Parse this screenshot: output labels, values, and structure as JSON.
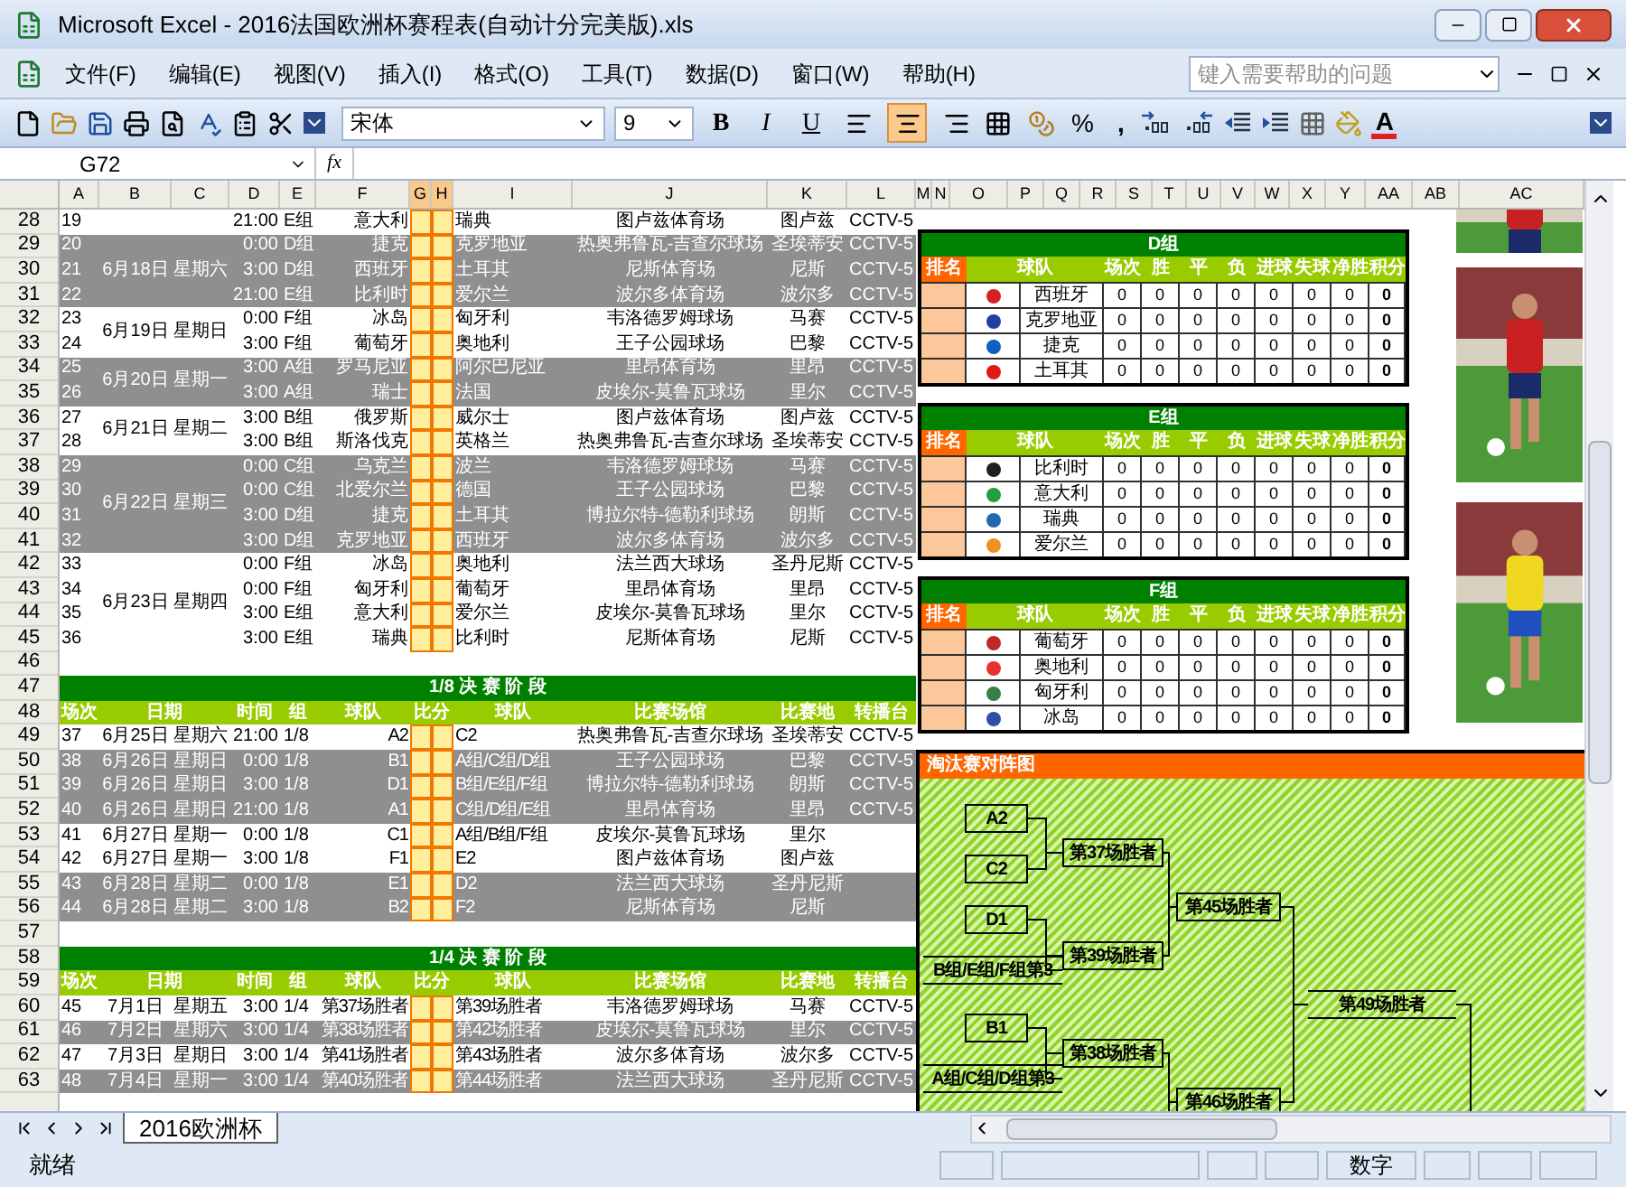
{
  "window": {
    "title": "Microsoft Excel - 2016法国欧洲杯赛程表(自动计分完美版).xls"
  },
  "menu": [
    "文件(F)",
    "编辑(E)",
    "视图(V)",
    "插入(I)",
    "格式(O)",
    "工具(T)",
    "数据(D)",
    "窗口(W)",
    "帮助(H)"
  ],
  "help_box": {
    "placeholder": "键入需要帮助的问题"
  },
  "toolbar": {
    "font": "宋体",
    "size": "9",
    "style_buttons": [
      "B",
      "I",
      "U"
    ],
    "align": [
      {
        "selected": false
      },
      {
        "selected": true
      },
      {
        "selected": false
      }
    ],
    "percent": "%",
    "comma": ",",
    "font_color": "A"
  },
  "formula_bar": {
    "name_box": "G72",
    "fx": "fx"
  },
  "columns": [
    {
      "label": "A",
      "selected": false
    },
    {
      "label": "B",
      "selected": false
    },
    {
      "label": "C",
      "selected": false
    },
    {
      "label": "D",
      "selected": false
    },
    {
      "label": "E",
      "selected": false
    },
    {
      "label": "F",
      "selected": false
    },
    {
      "label": "G",
      "selected": true
    },
    {
      "label": "H",
      "selected": true
    },
    {
      "label": "I",
      "selected": false
    },
    {
      "label": "J",
      "selected": false
    },
    {
      "label": "K",
      "selected": false
    },
    {
      "label": "L",
      "selected": false
    },
    {
      "label": "M",
      "selected": false
    },
    {
      "label": "N",
      "selected": false
    },
    {
      "label": "O",
      "selected": false
    },
    {
      "label": "P",
      "selected": false
    },
    {
      "label": "Q",
      "selected": false
    },
    {
      "label": "R",
      "selected": false
    },
    {
      "label": "S",
      "selected": false
    },
    {
      "label": "T",
      "selected": false
    },
    {
      "label": "U",
      "selected": false
    },
    {
      "label": "V",
      "selected": false
    },
    {
      "label": "W",
      "selected": false
    },
    {
      "label": "X",
      "selected": false
    },
    {
      "label": "Y",
      "selected": false
    },
    {
      "label": "AA",
      "selected": false
    },
    {
      "label": "AB",
      "selected": false
    },
    {
      "label": "AC",
      "selected": false
    }
  ],
  "row_numbers": [
    "28",
    "29",
    "30",
    "31",
    "32",
    "33",
    "34",
    "35",
    "36",
    "37",
    "38",
    "39",
    "40",
    "41",
    "42",
    "43",
    "44",
    "45",
    "46",
    "47",
    "48",
    "49",
    "50",
    "51",
    "52",
    "53",
    "54",
    "55",
    "56",
    "57",
    "58",
    "59",
    "60",
    "61",
    "62",
    "63"
  ],
  "group_stage": [
    {
      "shaded": false,
      "matches": [
        {
          "no": "19",
          "time": "21:00",
          "group": "E组",
          "team1": "意大利",
          "team2": "瑞典",
          "venue": "图卢兹体育场",
          "city": "图卢兹",
          "tv": "CCTV-5"
        }
      ]
    },
    {
      "date": "6月18日",
      "weekday": "星期六",
      "shaded": true,
      "matches": [
        {
          "no": "20",
          "time": "0:00",
          "group": "D组",
          "team1": "捷克",
          "team2": "克罗地亚",
          "venue": "热奥弗鲁瓦-吉查尔球场",
          "city": "圣埃蒂安",
          "tv": "CCTV-5"
        },
        {
          "no": "21",
          "time": "3:00",
          "group": "D组",
          "team1": "西班牙",
          "team2": "土耳其",
          "venue": "尼斯体育场",
          "city": "尼斯",
          "tv": "CCTV-5"
        },
        {
          "no": "22",
          "time": "21:00",
          "group": "E组",
          "team1": "比利时",
          "team2": "爱尔兰",
          "venue": "波尔多体育场",
          "city": "波尔多",
          "tv": "CCTV-5"
        }
      ]
    },
    {
      "date": "6月19日",
      "weekday": "星期日",
      "shaded": false,
      "matches": [
        {
          "no": "23",
          "time": "0:00",
          "group": "F组",
          "team1": "冰岛",
          "team2": "匈牙利",
          "venue": "韦洛德罗姆球场",
          "city": "马赛",
          "tv": "CCTV-5"
        },
        {
          "no": "24",
          "time": "3:00",
          "group": "F组",
          "team1": "葡萄牙",
          "team2": "奥地利",
          "venue": "王子公园球场",
          "city": "巴黎",
          "tv": "CCTV-5"
        }
      ]
    },
    {
      "date": "6月20日",
      "weekday": "星期一",
      "shaded": true,
      "matches": [
        {
          "no": "25",
          "time": "3:00",
          "group": "A组",
          "team1": "罗马尼亚",
          "team2": "阿尔巴尼亚",
          "venue": "里昂体育场",
          "city": "里昂",
          "tv": "CCTV-5"
        },
        {
          "no": "26",
          "time": "3:00",
          "group": "A组",
          "team1": "瑞士",
          "team2": "法国",
          "venue": "皮埃尔-莫鲁瓦球场",
          "city": "里尔",
          "tv": "CCTV-5"
        }
      ]
    },
    {
      "date": "6月21日",
      "weekday": "星期二",
      "shaded": false,
      "matches": [
        {
          "no": "27",
          "time": "3:00",
          "group": "B组",
          "team1": "俄罗斯",
          "team2": "威尔士",
          "venue": "图卢兹体育场",
          "city": "图卢兹",
          "tv": "CCTV-5"
        },
        {
          "no": "28",
          "time": "3:00",
          "group": "B组",
          "team1": "斯洛伐克",
          "team2": "英格兰",
          "venue": "热奥弗鲁瓦-吉查尔球场",
          "city": "圣埃蒂安",
          "tv": "CCTV-5"
        }
      ]
    },
    {
      "date": "6月22日",
      "weekday": "星期三",
      "shaded": true,
      "matches": [
        {
          "no": "29",
          "time": "0:00",
          "group": "C组",
          "team1": "乌克兰",
          "team2": "波兰",
          "venue": "韦洛德罗姆球场",
          "city": "马赛",
          "tv": "CCTV-5"
        },
        {
          "no": "30",
          "time": "0:00",
          "group": "C组",
          "team1": "北爱尔兰",
          "team2": "德国",
          "venue": "王子公园球场",
          "city": "巴黎",
          "tv": "CCTV-5"
        },
        {
          "no": "31",
          "time": "3:00",
          "group": "D组",
          "team1": "捷克",
          "team2": "土耳其",
          "venue": "博拉尔特-德勒利球场",
          "city": "朗斯",
          "tv": "CCTV-5"
        },
        {
          "no": "32",
          "time": "3:00",
          "group": "D组",
          "team1": "克罗地亚",
          "team2": "西班牙",
          "venue": "波尔多体育场",
          "city": "波尔多",
          "tv": "CCTV-5"
        }
      ]
    },
    {
      "date": "6月23日",
      "weekday": "星期四",
      "shaded": false,
      "matches": [
        {
          "no": "33",
          "time": "0:00",
          "group": "F组",
          "team1": "冰岛",
          "team2": "奥地利",
          "venue": "法兰西大球场",
          "city": "圣丹尼斯",
          "tv": "CCTV-5"
        },
        {
          "no": "34",
          "time": "0:00",
          "group": "F组",
          "team1": "匈牙利",
          "team2": "葡萄牙",
          "venue": "里昂体育场",
          "city": "里昂",
          "tv": "CCTV-5"
        },
        {
          "no": "35",
          "time": "3:00",
          "group": "E组",
          "team1": "意大利",
          "team2": "爱尔兰",
          "venue": "皮埃尔-莫鲁瓦球场",
          "city": "里尔",
          "tv": "CCTV-5"
        },
        {
          "no": "36",
          "time": "3:00",
          "group": "E组",
          "team1": "瑞典",
          "team2": "比利时",
          "venue": "尼斯体育场",
          "city": "尼斯",
          "tv": "CCTV-5"
        }
      ]
    }
  ],
  "knockout_sections": [
    {
      "title": "1/8 决 赛 阶 段",
      "headers": [
        "场次",
        "日期",
        "时间",
        "组",
        "球队",
        "比分",
        "球队",
        "比赛场馆",
        "比赛地",
        "转播台"
      ],
      "matches": [
        {
          "no": "37",
          "date": "6月25日",
          "weekday": "星期六",
          "time": "21:00",
          "round": "1/8",
          "team1": "A2",
          "team2": "C2",
          "venue": "热奥弗鲁瓦-吉查尔球场",
          "city": "圣埃蒂安",
          "tv": "CCTV-5",
          "shaded": false
        },
        {
          "no": "38",
          "date": "6月26日",
          "weekday": "星期日",
          "time": "0:00",
          "round": "1/8",
          "team1": "B1",
          "team2": "A组/C组/D组",
          "venue": "王子公园球场",
          "city": "巴黎",
          "tv": "CCTV-5",
          "shaded": true
        },
        {
          "no": "39",
          "date": "6月26日",
          "weekday": "星期日",
          "time": "3:00",
          "round": "1/8",
          "team1": "D1",
          "team2": "B组/E组/F组",
          "venue": "博拉尔特-德勒利球场",
          "city": "朗斯",
          "tv": "CCTV-5",
          "shaded": true
        },
        {
          "no": "40",
          "date": "6月26日",
          "weekday": "星期日",
          "time": "21:00",
          "round": "1/8",
          "team1": "A1",
          "team2": "C组/D组/E组",
          "venue": "里昂体育场",
          "city": "里昂",
          "tv": "CCTV-5",
          "shaded": true
        },
        {
          "no": "41",
          "date": "6月27日",
          "weekday": "星期一",
          "time": "0:00",
          "round": "1/8",
          "team1": "C1",
          "team2": "A组/B组/F组",
          "venue": "皮埃尔-莫鲁瓦球场",
          "city": "里尔",
          "shaded": false
        },
        {
          "no": "42",
          "date": "6月27日",
          "weekday": "星期一",
          "time": "3:00",
          "round": "1/8",
          "team1": "F1",
          "team2": "E2",
          "venue": "图卢兹体育场",
          "city": "图卢兹",
          "shaded": false
        },
        {
          "no": "43",
          "date": "6月28日",
          "weekday": "星期二",
          "time": "0:00",
          "round": "1/8",
          "team1": "E1",
          "team2": "D2",
          "venue": "法兰西大球场",
          "city": "圣丹尼斯",
          "shaded": true
        },
        {
          "no": "44",
          "date": "6月28日",
          "weekday": "星期二",
          "time": "3:00",
          "round": "1/8",
          "team1": "B2",
          "team2": "F2",
          "venue": "尼斯体育场",
          "city": "尼斯",
          "shaded": true
        }
      ]
    },
    {
      "title": "1/4 决 赛 阶 段",
      "headers": [
        "场次",
        "日期",
        "时间",
        "组",
        "球队",
        "比分",
        "球队",
        "比赛场馆",
        "比赛地",
        "转播台"
      ],
      "matches": [
        {
          "no": "45",
          "date": "7月1日",
          "weekday": "星期五",
          "time": "3:00",
          "round": "1/4",
          "team1": "第37场胜者",
          "team2": "第39场胜者",
          "venue": "韦洛德罗姆球场",
          "city": "马赛",
          "tv": "CCTV-5",
          "shaded": false
        },
        {
          "no": "46",
          "date": "7月2日",
          "weekday": "星期六",
          "time": "3:00",
          "round": "1/4",
          "team1": "第38场胜者",
          "team2": "第42场胜者",
          "venue": "皮埃尔-莫鲁瓦球场",
          "city": "里尔",
          "tv": "CCTV-5",
          "shaded": true
        },
        {
          "no": "47",
          "date": "7月3日",
          "weekday": "星期日",
          "time": "3:00",
          "round": "1/4",
          "team1": "第41场胜者",
          "team2": "第43场胜者",
          "venue": "波尔多体育场",
          "city": "波尔多",
          "tv": "CCTV-5",
          "shaded": false
        },
        {
          "no": "48",
          "date": "7月4日",
          "weekday": "星期一",
          "time": "3:00",
          "round": "1/4",
          "team1": "第40场胜者",
          "team2": "第44场胜者",
          "venue": "法兰西大球场",
          "city": "圣丹尼斯",
          "tv": "CCTV-5",
          "shaded": true
        }
      ]
    }
  ],
  "group_tables": [
    {
      "title": "D组",
      "headers": [
        "排名",
        "球队",
        "场次",
        "胜",
        "平",
        "负",
        "进球",
        "失球",
        "净胜",
        "积分"
      ],
      "teams": [
        {
          "name": "西班牙",
          "color": "#d42020",
          "stats": [
            "0",
            "0",
            "0",
            "0",
            "0",
            "0",
            "0",
            "0"
          ]
        },
        {
          "name": "克罗地亚",
          "color": "#2040a0",
          "stats": [
            "0",
            "0",
            "0",
            "0",
            "0",
            "0",
            "0",
            "0"
          ]
        },
        {
          "name": "捷克",
          "color": "#1060c0",
          "stats": [
            "0",
            "0",
            "0",
            "0",
            "0",
            "0",
            "0",
            "0"
          ]
        },
        {
          "name": "土耳其",
          "color": "#e01818",
          "stats": [
            "0",
            "0",
            "0",
            "0",
            "0",
            "0",
            "0",
            "0"
          ]
        }
      ]
    },
    {
      "title": "E组",
      "headers": [
        "排名",
        "球队",
        "场次",
        "胜",
        "平",
        "负",
        "进球",
        "失球",
        "净胜",
        "积分"
      ],
      "teams": [
        {
          "name": "比利时",
          "color": "#202020",
          "stats": [
            "0",
            "0",
            "0",
            "0",
            "0",
            "0",
            "0",
            "0"
          ]
        },
        {
          "name": "意大利",
          "color": "#20a040",
          "stats": [
            "0",
            "0",
            "0",
            "0",
            "0",
            "0",
            "0",
            "0"
          ]
        },
        {
          "name": "瑞典",
          "color": "#2068b0",
          "stats": [
            "0",
            "0",
            "0",
            "0",
            "0",
            "0",
            "0",
            "0"
          ]
        },
        {
          "name": "爱尔兰",
          "color": "#f09020",
          "stats": [
            "0",
            "0",
            "0",
            "0",
            "0",
            "0",
            "0",
            "0"
          ]
        }
      ]
    },
    {
      "title": "F组",
      "headers": [
        "排名",
        "球队",
        "场次",
        "胜",
        "平",
        "负",
        "进球",
        "失球",
        "净胜",
        "积分"
      ],
      "teams": [
        {
          "name": "葡萄牙",
          "color": "#c02828",
          "stats": [
            "0",
            "0",
            "0",
            "0",
            "0",
            "0",
            "0",
            "0"
          ]
        },
        {
          "name": "奥地利",
          "color": "#e83030",
          "stats": [
            "0",
            "0",
            "0",
            "0",
            "0",
            "0",
            "0",
            "0"
          ]
        },
        {
          "name": "匈牙利",
          "color": "#388048",
          "stats": [
            "0",
            "0",
            "0",
            "0",
            "0",
            "0",
            "0",
            "0"
          ]
        },
        {
          "name": "冰岛",
          "color": "#3050a8",
          "stats": [
            "0",
            "0",
            "0",
            "0",
            "0",
            "0",
            "0",
            "0"
          ]
        }
      ]
    }
  ],
  "bracket": {
    "title": "淘汰赛对阵图",
    "nodes": [
      {
        "label": "A2",
        "kind": "box"
      },
      {
        "label": "C2",
        "kind": "box"
      },
      {
        "label": "D1",
        "kind": "box"
      },
      {
        "label": "B组/E组/F组第3",
        "kind": "line"
      },
      {
        "label": "B1",
        "kind": "box"
      },
      {
        "label": "A组/C组/D组第3",
        "kind": "line"
      },
      {
        "label": "第37场胜者",
        "kind": "box"
      },
      {
        "label": "第39场胜者",
        "kind": "box"
      },
      {
        "label": "第45场胜者",
        "kind": "box"
      },
      {
        "label": "第38场胜者",
        "kind": "box"
      },
      {
        "label": "第46场胜者",
        "kind": "box"
      },
      {
        "label": "第49场胜者",
        "kind": "line"
      }
    ]
  },
  "sheet_tabs": [
    {
      "label": "2016欧洲杯",
      "selected": true
    }
  ],
  "status_bar": {
    "left": "就绪",
    "mode": "数字"
  }
}
